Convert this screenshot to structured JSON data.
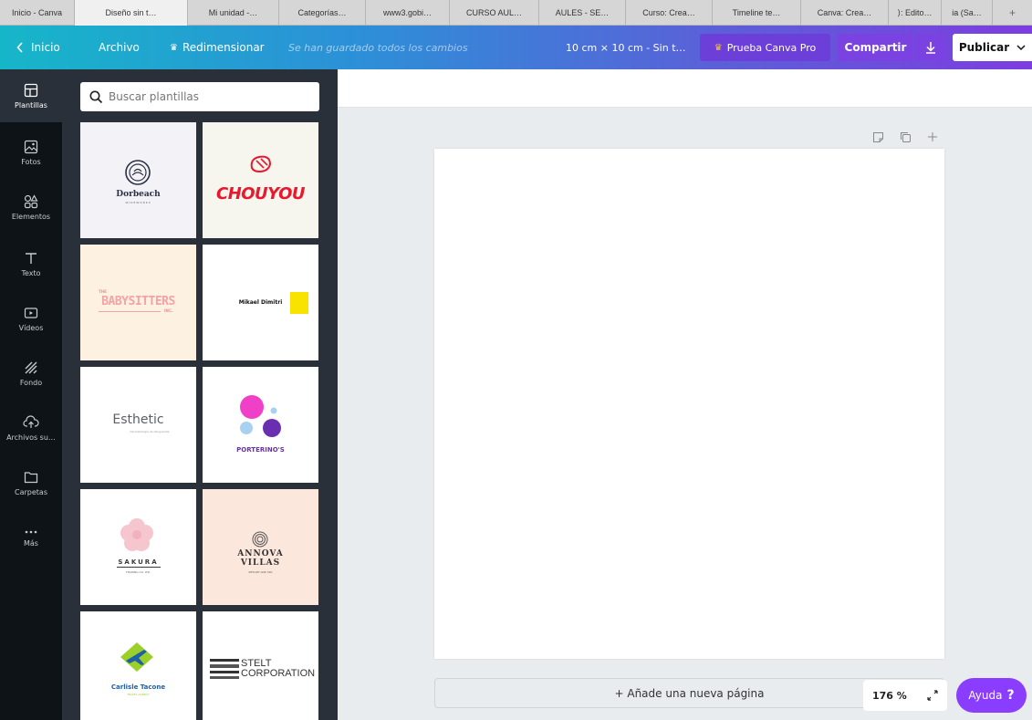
{
  "browser_tabs": [
    {
      "label": "Inicio - Canva",
      "active": false
    },
    {
      "label": "Diseño sin t…",
      "active": true
    },
    {
      "label": "Mi unidad -…",
      "active": false
    },
    {
      "label": "Categorías…",
      "active": false
    },
    {
      "label": "www3.gobi…",
      "active": false
    },
    {
      "label": "CURSO AUL…",
      "active": false
    },
    {
      "label": "AULES - SE…",
      "active": false
    },
    {
      "label": "Curso: Crea…",
      "active": false
    },
    {
      "label": "Timeline te…",
      "active": false
    },
    {
      "label": "Canva: Crea…",
      "active": false
    },
    {
      "label": "⟩: Edito…",
      "active": false
    },
    {
      "label": "ia (Sa…",
      "active": false
    }
  ],
  "header": {
    "back_label": "Inicio",
    "file_label": "Archivo",
    "resize_label": "Redimensionar",
    "saved_status": "Se han guardado todos los cambios",
    "design_title": "10 cm × 10 cm - Sin t…",
    "pro_label": "Prueba Canva Pro",
    "share_label": "Compartir",
    "publish_label": "Publicar"
  },
  "sidebar": {
    "items": [
      {
        "label": "Plantillas",
        "icon": "templates-icon"
      },
      {
        "label": "Fotos",
        "icon": "photos-icon"
      },
      {
        "label": "Elementos",
        "icon": "elements-icon"
      },
      {
        "label": "Texto",
        "icon": "text-icon"
      },
      {
        "label": "Vídeos",
        "icon": "video-icon"
      },
      {
        "label": "Fondo",
        "icon": "background-icon"
      },
      {
        "label": "Archivos su…",
        "icon": "uploads-icon"
      },
      {
        "label": "Carpetas",
        "icon": "folder-icon"
      },
      {
        "label": "Más",
        "icon": "more-icon"
      }
    ]
  },
  "panel": {
    "search_placeholder": "Buscar plantillas",
    "templates": [
      {
        "name": "Dorbeach",
        "sub": "WIDEWORKS"
      },
      {
        "name": "CHOUYOU"
      },
      {
        "name": "BABYSITTERS",
        "pre": "THE",
        "sub": "INC."
      },
      {
        "name": "Mikael Dimitri"
      },
      {
        "name": "Esthetic",
        "sub": "Dermatología de Vanguardia"
      },
      {
        "name": "PORTERINO'S"
      },
      {
        "name": "SAKURA",
        "sub": "TRADING CO. LTD."
      },
      {
        "name": "ANNOVA",
        "name2": "VILLAS",
        "sub": "RESORT AND SPA"
      },
      {
        "name": "Carlisle Tacone",
        "sub": "TRAVEL AGENCY"
      },
      {
        "name": "STELT",
        "name2": "CORPORATION"
      }
    ]
  },
  "editor": {
    "add_page_label": "+ Añade una nueva página",
    "zoom_level": "176 %",
    "help_label": "Ayuda",
    "help_mark": "?"
  }
}
